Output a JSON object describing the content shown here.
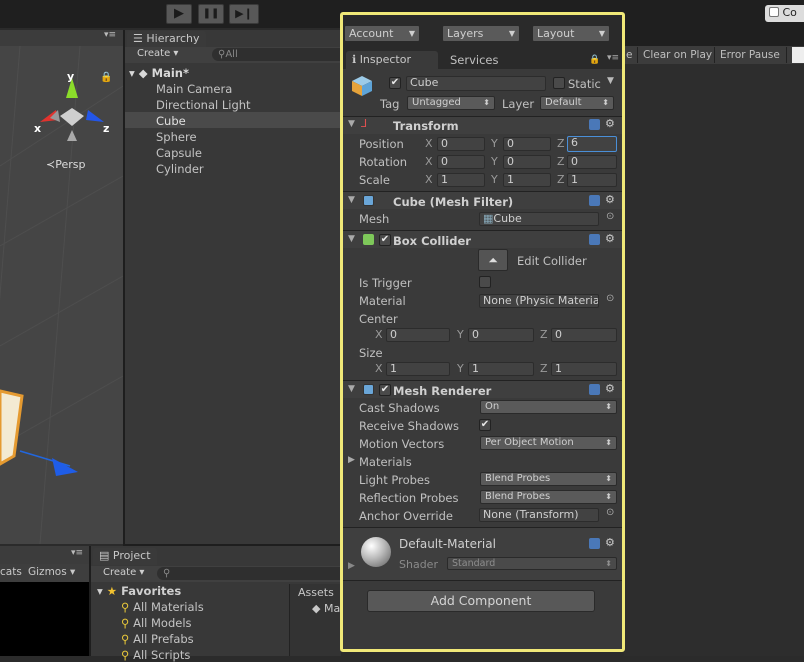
{
  "top": {
    "play_icon": "▶",
    "pause_icon": "❚❚",
    "step_icon": "▶❙",
    "co_label": "Co"
  },
  "console_toolbar": {
    "clear_on_play": "Clear on Play",
    "error_pause": "Error Pause",
    "partial_e": "e"
  },
  "scene": {
    "persp": "≺Persp",
    "gizmo_y": "y",
    "gizmo_x": "x",
    "gizmo_z": "z",
    "bottom_tab_partial": "cats",
    "gizmos": "Gizmos"
  },
  "hierarchy": {
    "tab": "Hierarchy",
    "create": "Create",
    "search_placeholder": "All",
    "scene_name": "Main*",
    "items": [
      "Main Camera",
      "Directional Light",
      "Cube",
      "Sphere",
      "Capsule",
      "Cylinder"
    ]
  },
  "project": {
    "tab": "Project",
    "create": "Create",
    "favorites": "Favorites",
    "fav_items": [
      "All Materials",
      "All Models",
      "All Prefabs",
      "All Scripts"
    ],
    "assets": "Assets",
    "asset_item": "Ma"
  },
  "inspector": {
    "account": "Account",
    "layers": "Layers",
    "layout": "Layout",
    "tab_inspector": "Inspector",
    "tab_services": "Services",
    "object_name": "Cube",
    "static_label": "Static",
    "tag_label": "Tag",
    "tag_value": "Untagged",
    "layer_label": "Layer",
    "layer_value": "Default",
    "transform": {
      "title": "Transform",
      "position_label": "Position",
      "rotation_label": "Rotation",
      "scale_label": "Scale",
      "position": {
        "x": "0",
        "y": "0",
        "z": "6"
      },
      "rotation": {
        "x": "0",
        "y": "0",
        "z": "0"
      },
      "scale": {
        "x": "1",
        "y": "1",
        "z": "1"
      }
    },
    "mesh_filter": {
      "title": "Cube (Mesh Filter)",
      "mesh_label": "Mesh",
      "mesh_value": "Cube"
    },
    "box_collider": {
      "title": "Box Collider",
      "edit_collider": "Edit Collider",
      "is_trigger_label": "Is Trigger",
      "material_label": "Material",
      "material_value": "None (Physic Materia",
      "center_label": "Center",
      "center": {
        "x": "0",
        "y": "0",
        "z": "0"
      },
      "size_label": "Size",
      "size": {
        "x": "1",
        "y": "1",
        "z": "1"
      }
    },
    "mesh_renderer": {
      "title": "Mesh Renderer",
      "cast_shadows_label": "Cast Shadows",
      "cast_shadows_value": "On",
      "receive_shadows_label": "Receive Shadows",
      "motion_vectors_label": "Motion Vectors",
      "motion_vectors_value": "Per Object Motion",
      "materials_label": "Materials",
      "light_probes_label": "Light Probes",
      "light_probes_value": "Blend Probes",
      "reflection_probes_label": "Reflection Probes",
      "reflection_probes_value": "Blend Probes",
      "anchor_override_label": "Anchor Override",
      "anchor_override_value": "None (Transform)"
    },
    "material": {
      "name": "Default-Material",
      "shader_label": "Shader",
      "shader_value": "Standard"
    },
    "add_component": "Add Component",
    "axis": {
      "x": "X",
      "y": "Y",
      "z": "Z"
    }
  },
  "colors": {
    "highlight_border": "#f0e878",
    "panel": "#3a3a3a",
    "selected_row": "#4a4a4a"
  }
}
